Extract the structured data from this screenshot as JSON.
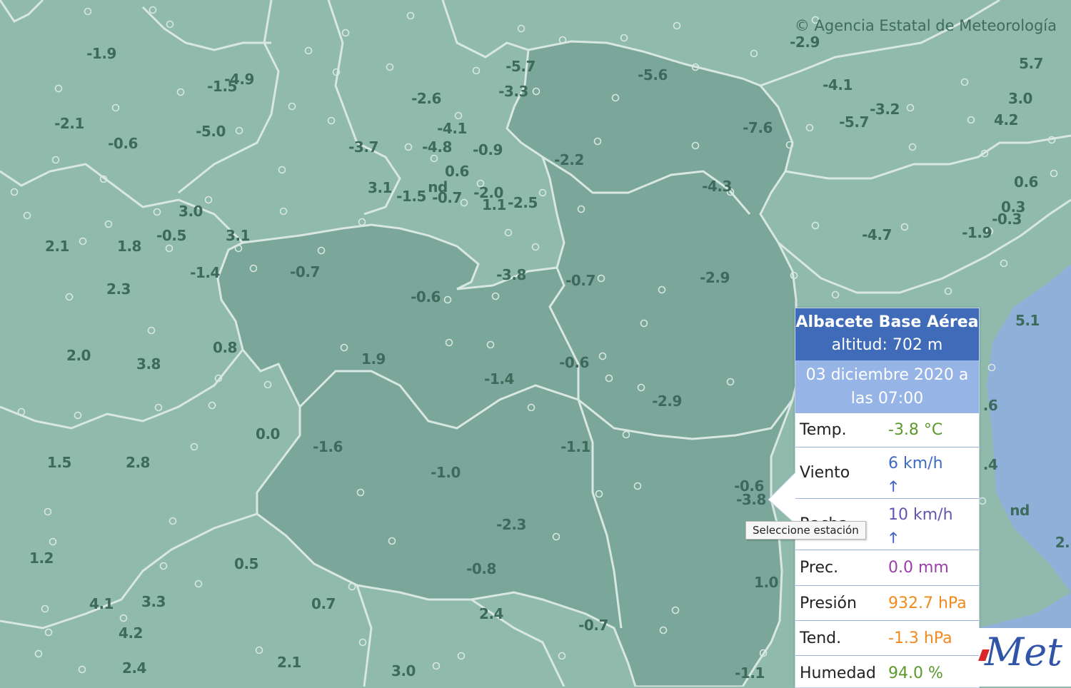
{
  "map": {
    "copyright": "© Agencia Estatal de Meteorología",
    "colors": {
      "outer": "#8fbaac",
      "region": "#7aa799",
      "sea": "#8fb0d8",
      "label": "#3d6a5c",
      "border": "#d8e7e2"
    },
    "labels": [
      {
        "t": "-1.9"
      },
      {
        "t": "-1.5"
      },
      {
        "t": "-4.9"
      },
      {
        "t": "-2.1"
      },
      {
        "t": "-0.6"
      },
      {
        "t": "-5.0"
      },
      {
        "t": "-5.7"
      },
      {
        "t": "-3.3"
      },
      {
        "t": "-2.6"
      },
      {
        "t": "-5.6"
      },
      {
        "t": "-2.9"
      },
      {
        "t": "5.7"
      },
      {
        "t": "-4.1"
      },
      {
        "t": "3.0"
      },
      {
        "t": "-3.2"
      },
      {
        "t": "-5.7"
      },
      {
        "t": "4.2"
      },
      {
        "t": "-7.6"
      },
      {
        "t": "-4.1"
      },
      {
        "t": "-3.7"
      },
      {
        "t": "-4.8"
      },
      {
        "t": "-0.9"
      },
      {
        "t": "-2.2"
      },
      {
        "t": "0.6"
      },
      {
        "t": "3.1"
      },
      {
        "t": "-1.5"
      },
      {
        "t": "nd"
      },
      {
        "t": "-0.7"
      },
      {
        "t": "-2.0"
      },
      {
        "t": "1.1"
      },
      {
        "t": "-2.5"
      },
      {
        "t": "-4.3"
      },
      {
        "t": "0.6"
      },
      {
        "t": "3.0"
      },
      {
        "t": "0.3"
      },
      {
        "t": "-0.3"
      },
      {
        "t": "-4.7"
      },
      {
        "t": "-1.9"
      },
      {
        "t": "2.1"
      },
      {
        "t": "1.8"
      },
      {
        "t": "-0.5"
      },
      {
        "t": "3.1"
      },
      {
        "t": "-1.4"
      },
      {
        "t": "-0.7"
      },
      {
        "t": "-3.8"
      },
      {
        "t": "-0.7"
      },
      {
        "t": "-2.9"
      },
      {
        "t": "2.3"
      },
      {
        "t": "-0.6"
      },
      {
        "t": "5.1"
      },
      {
        "t": "0.8"
      },
      {
        "t": "2.0"
      },
      {
        "t": "3.8"
      },
      {
        "t": "1.9"
      },
      {
        "t": "-1.4"
      },
      {
        "t": "-0.6"
      },
      {
        "t": "-2.9"
      },
      {
        "t": ".6"
      },
      {
        "t": "0.0"
      },
      {
        "t": "-1.6"
      },
      {
        "t": "-1.1"
      },
      {
        "t": "1.5"
      },
      {
        "t": "2.8"
      },
      {
        "t": "-1.0"
      },
      {
        "t": ".4"
      },
      {
        "t": "-0.6"
      },
      {
        "t": "-3.8"
      },
      {
        "t": "nd"
      },
      {
        "t": "-2.3"
      },
      {
        "t": "1.2"
      },
      {
        "t": "2."
      },
      {
        "t": "0.5"
      },
      {
        "t": "-0.8"
      },
      {
        "t": "1.0"
      },
      {
        "t": "4.1"
      },
      {
        "t": "3.3"
      },
      {
        "t": "0.7"
      },
      {
        "t": "2.4"
      },
      {
        "t": "-0.7"
      },
      {
        "t": "4.2"
      },
      {
        "t": "2.4"
      },
      {
        "t": "2.1"
      },
      {
        "t": "3.0"
      },
      {
        "t": "-1.1"
      }
    ]
  },
  "popup": {
    "station": "Albacete Base Aérea",
    "altitude": "altitud: 702 m",
    "date_line1": "03 diciembre 2020 a",
    "date_line2": "las 07:00",
    "rows": [
      {
        "label": "Temp.",
        "value": "-3.8 °C",
        "color": "#5a9a2a"
      },
      {
        "label": "Viento",
        "value": "6 km/h",
        "color": "#3e6ac2"
      },
      {
        "label": "Racha",
        "value": "10 km/h",
        "color": "#6655b0"
      },
      {
        "label": "Prec.",
        "value": "0.0 mm",
        "color": "#9a3fa8"
      },
      {
        "label": "Presión",
        "value": "932.7 hPa",
        "color": "#f08a1e"
      },
      {
        "label": "Tend.",
        "value": "-1.3 hPa",
        "color": "#f08a1e"
      },
      {
        "label": "Humedad",
        "value": "94.0 %",
        "color": "#5a9a2a"
      }
    ],
    "wind_arrow": "🡑"
  },
  "tooltip": "Seleccione estación",
  "logo": "Met"
}
